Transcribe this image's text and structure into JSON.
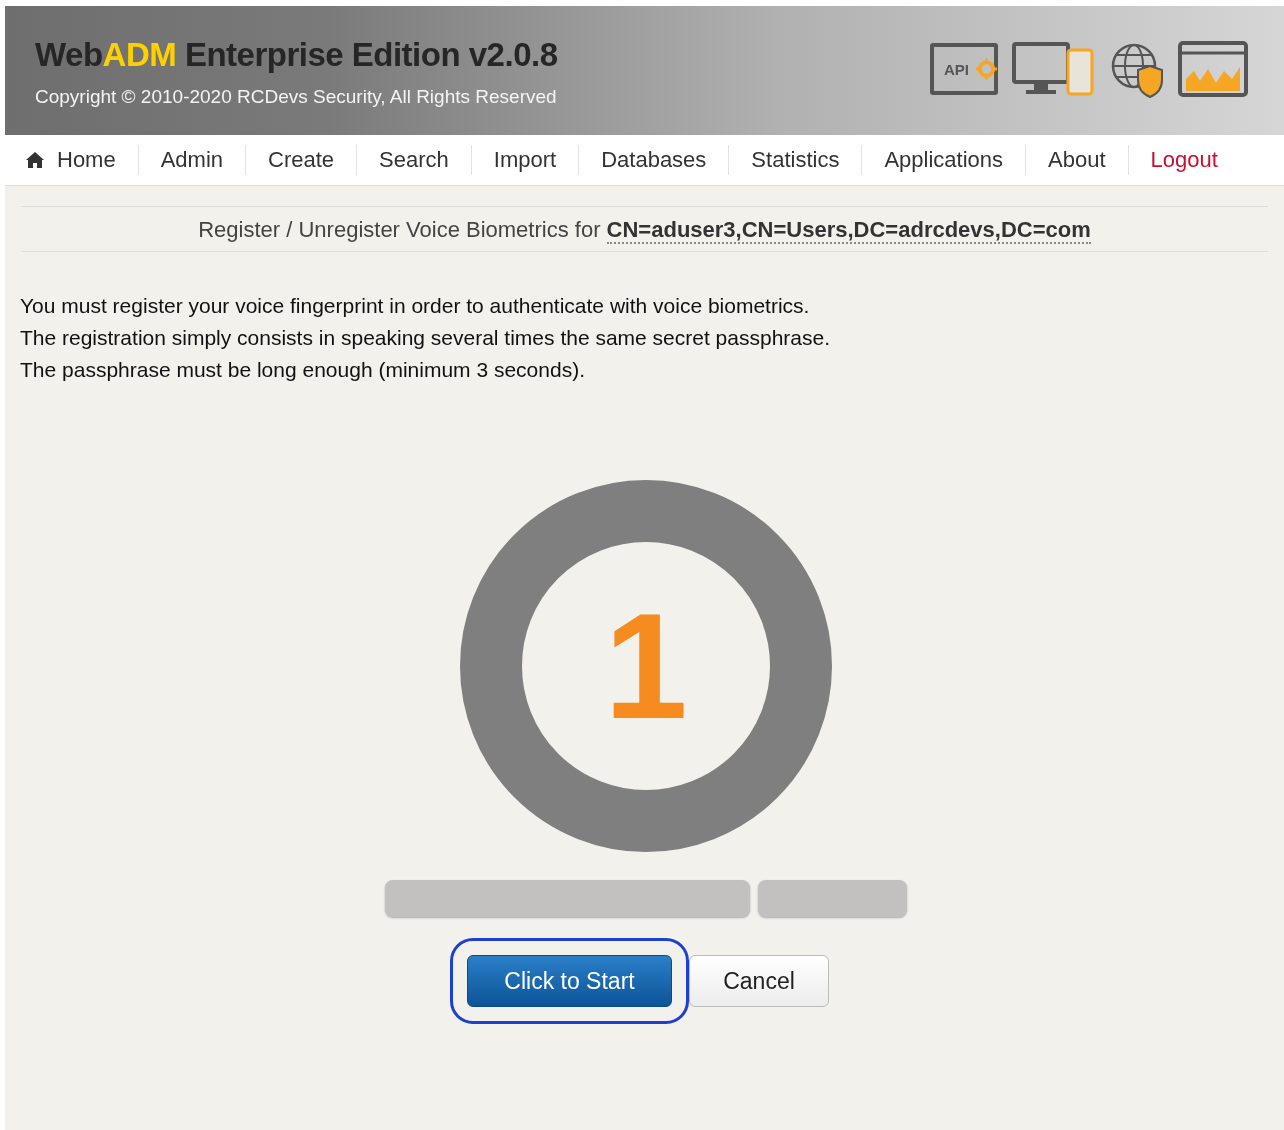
{
  "header": {
    "brand": {
      "prefix": "Web",
      "highlight": "ADM",
      "rest": " Enterprise Edition v2.0.8"
    },
    "copyright": "Copyright © 2010-2020 RCDevs Security, All Rights Reserved",
    "api_label": "API"
  },
  "nav": [
    {
      "label": "Home",
      "kind": "home"
    },
    {
      "label": "Admin",
      "kind": "link"
    },
    {
      "label": "Create",
      "kind": "link"
    },
    {
      "label": "Search",
      "kind": "link"
    },
    {
      "label": "Import",
      "kind": "link"
    },
    {
      "label": "Databases",
      "kind": "link"
    },
    {
      "label": "Statistics",
      "kind": "link"
    },
    {
      "label": "Applications",
      "kind": "link"
    },
    {
      "label": "About",
      "kind": "link"
    },
    {
      "label": "Logout",
      "kind": "logout"
    }
  ],
  "page_title": {
    "text": "Register / Unregister Voice Biometrics for ",
    "object": "CN=aduser3,CN=Users,DC=adrcdevs,DC=com"
  },
  "instructions": [
    "You must register your voice fingerprint in order to authenticate with voice biometrics.",
    "The registration simply consists in speaking several times the same secret passphrase.",
    "The passphrase must be long enough (minimum 3 seconds)."
  ],
  "counter": "1",
  "buttons": [
    {
      "label": "Click to Start",
      "kind": "primary",
      "focused": true
    },
    {
      "label": "Cancel",
      "kind": "secondary",
      "focused": false
    }
  ]
}
